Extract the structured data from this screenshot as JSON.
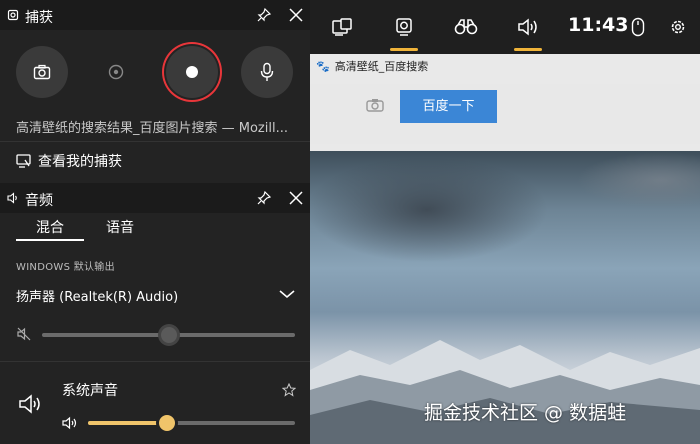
{
  "background": {
    "browser_tab_title": "高清壁纸_百度搜索",
    "search_button_label": "百度一下",
    "watermark": "掘金技术社区 @ 数据蛙"
  },
  "topbar": {
    "clock": "11:43",
    "items": [
      {
        "name": "widget-menu-icon"
      },
      {
        "name": "capture-icon",
        "active": true
      },
      {
        "name": "looking-for-group-icon"
      },
      {
        "name": "audio-icon",
        "active": true
      },
      {
        "name": "mouse-icon"
      },
      {
        "name": "settings-gear-icon"
      }
    ],
    "accent_color": "#F0B43A"
  },
  "capture_panel": {
    "title": "捕获",
    "source_text": "高清壁纸的搜索结果_百度图片搜索 — Mozill...",
    "gallery_link": "查看我的捕获",
    "record_ring_color": "#E8363A",
    "buttons": [
      {
        "name": "screenshot-button"
      },
      {
        "name": "record-last-button"
      },
      {
        "name": "start-recording-button"
      },
      {
        "name": "microphone-toggle-button"
      }
    ]
  },
  "audio_panel": {
    "title": "音频",
    "tabs": [
      {
        "label": "混合",
        "selected": true
      },
      {
        "label": "语音",
        "selected": false
      }
    ],
    "section_label": "WINDOWS 默认输出",
    "output_device": "扬声器 (Realtek(R) Audio)",
    "master_volume_fraction": 0.5,
    "app_name": "系统声音",
    "app_volume_fraction": 0.37,
    "app_slider_color": "#F0C46A"
  }
}
